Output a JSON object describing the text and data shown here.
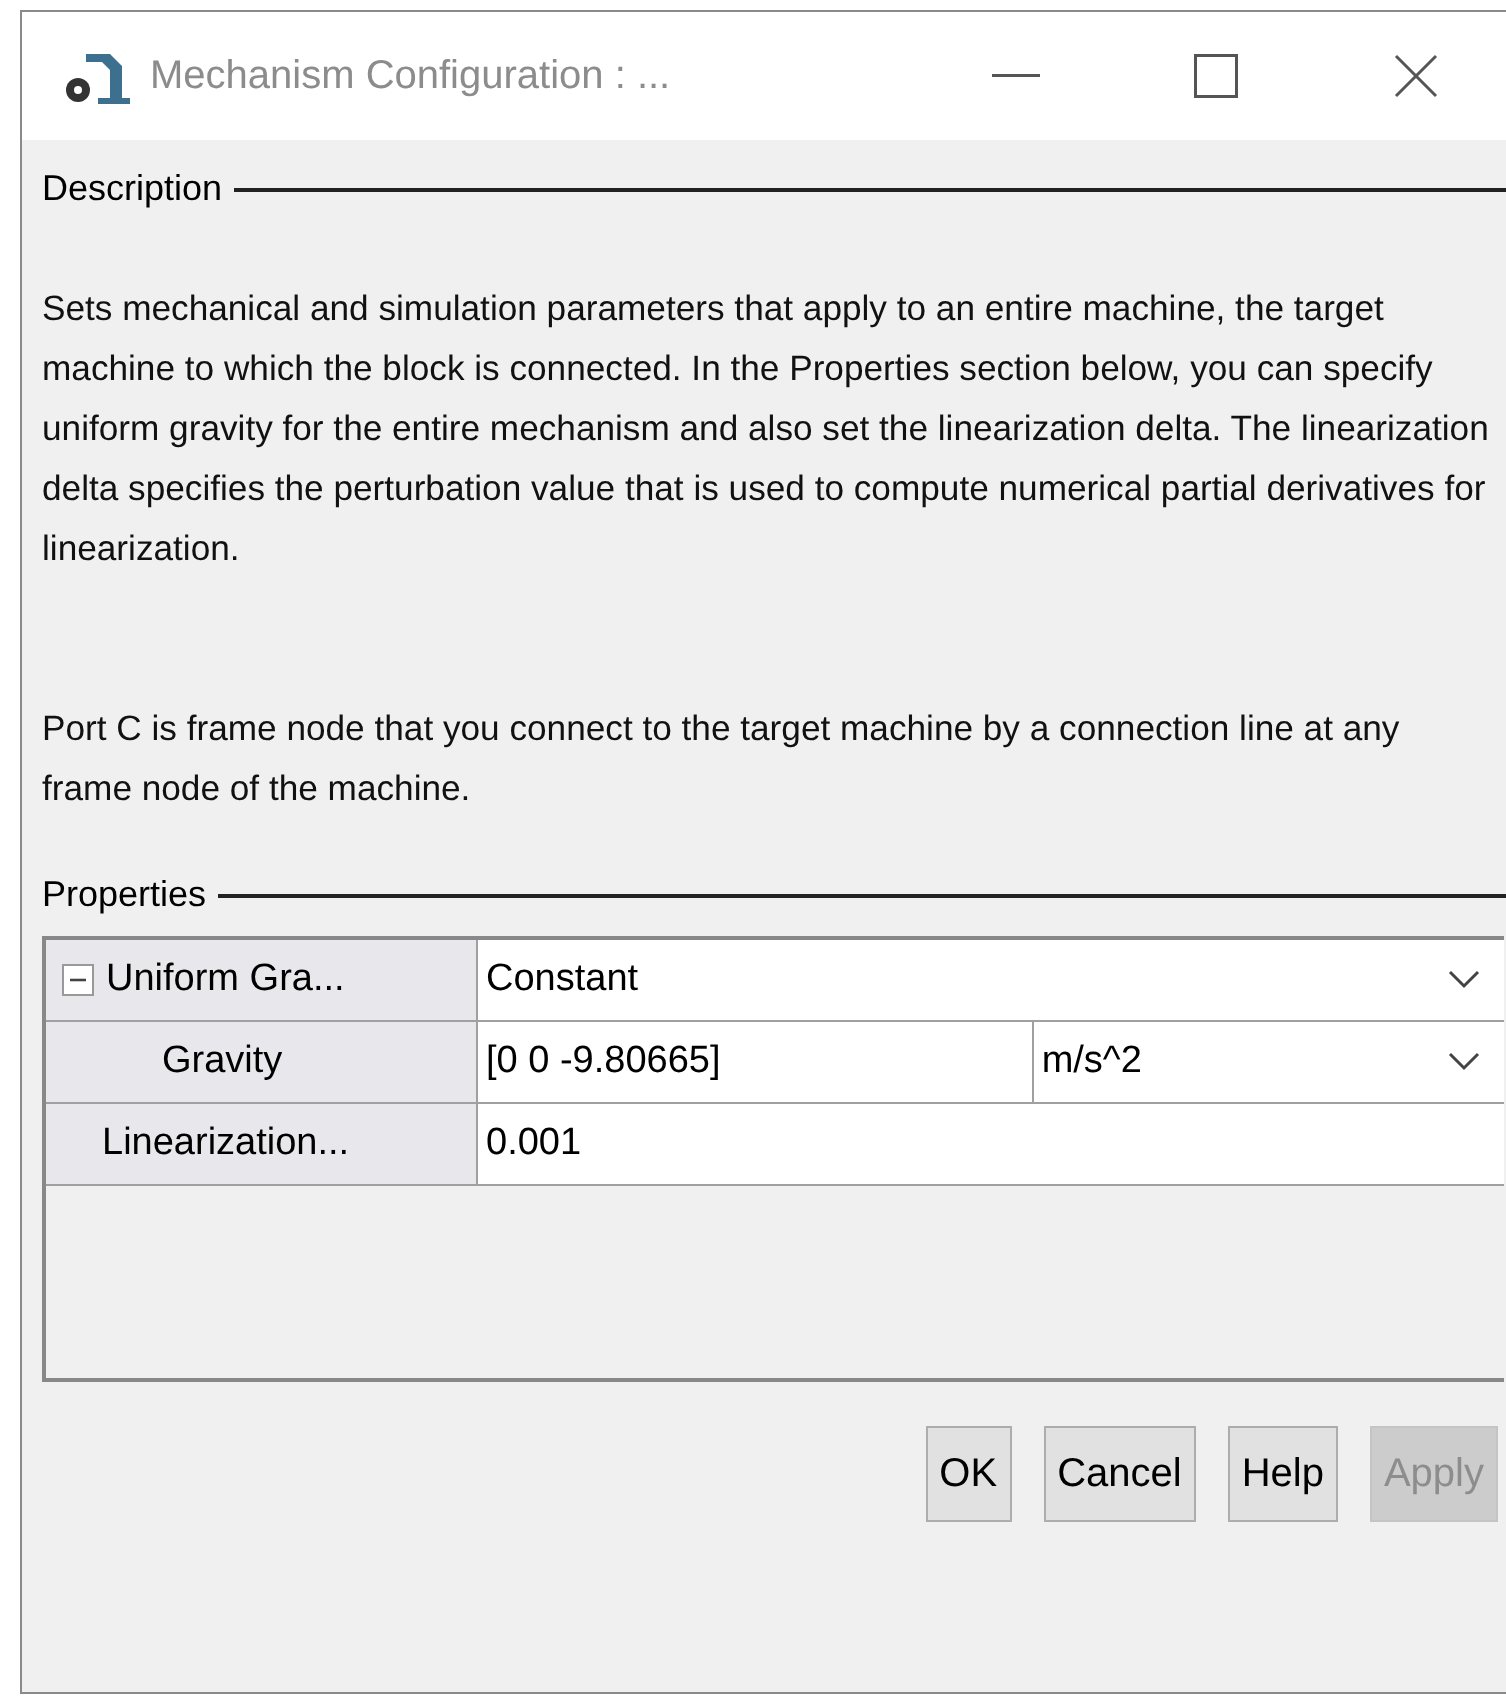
{
  "window": {
    "title": "Mechanism Configuration : ..."
  },
  "description": {
    "legend": "Description",
    "paragraphs": [
      "Sets mechanical and simulation parameters that apply to an entire machine, the target machine to which the block is connected. In the Properties section below, you can specify uniform gravity for the entire mechanism and also set the linearization delta. The linearization delta specifies the perturbation value that is used to compute numerical partial derivatives for linearization.",
      "Port C is frame node that you connect to the target machine by a connection line at any frame node of the machine."
    ]
  },
  "properties": {
    "legend": "Properties",
    "rows": [
      {
        "label": "Uniform Gra...",
        "value": "Constant",
        "dropdown": true,
        "expanded": true,
        "children": [
          {
            "label": "Gravity",
            "value": "[0 0 -9.80665]",
            "unit": "m/s^2",
            "dropdown": true
          }
        ]
      },
      {
        "label": "Linearization...",
        "value": "0.001",
        "dropdown": false
      }
    ]
  },
  "buttons": [
    {
      "label": "OK",
      "disabled": false
    },
    {
      "label": "Cancel",
      "disabled": false
    },
    {
      "label": "Help",
      "disabled": false
    },
    {
      "label": "Apply",
      "disabled": true
    }
  ]
}
